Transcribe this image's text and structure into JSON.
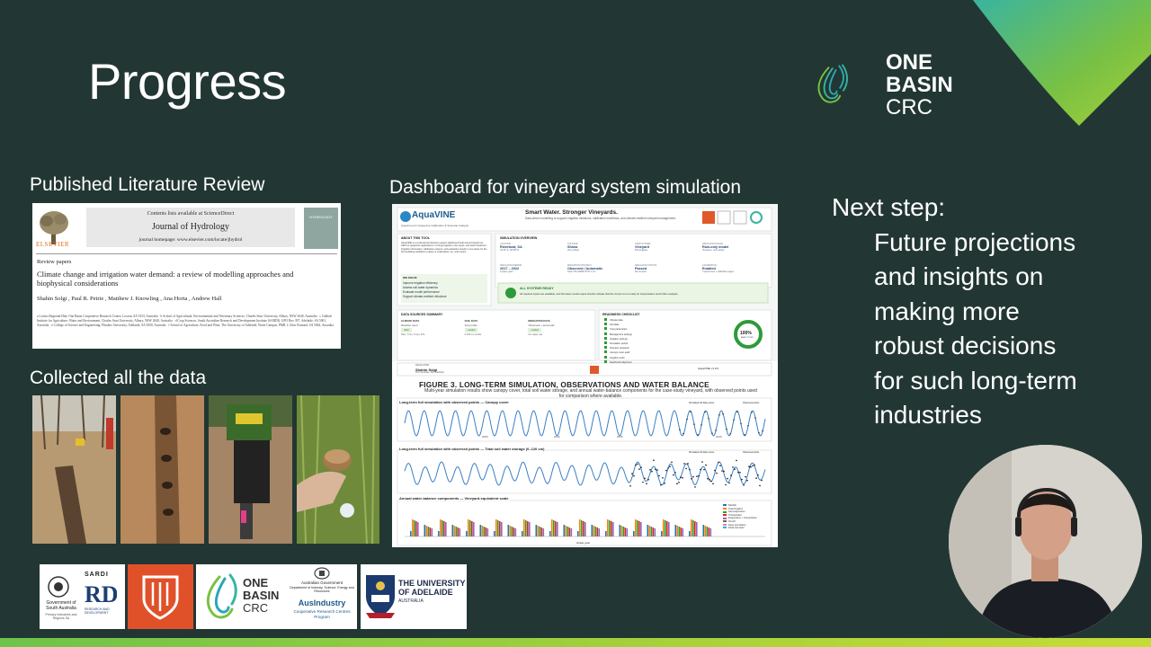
{
  "slide": {
    "title": "Progress",
    "brand_colors": {
      "background": "#223733",
      "accent_green": "#7ac143",
      "accent_teal": "#2aa7b5"
    }
  },
  "logo": {
    "line1": "ONE",
    "line2": "BASIN",
    "line3": "CRC"
  },
  "literature": {
    "heading": "Published Literature Review",
    "paper": {
      "contents_line": "Contents lists available at ScienceDirect",
      "journal": "Journal of Hydrology",
      "homepage": "journal homepage: www.elsevier.com/locate/jhydrol",
      "publisher": "ELSEVIER",
      "cover_label": "HYDROLOGY",
      "section": "Review papers",
      "title": "Climate change and irrigation water demand: a review of modelling approaches and biophysical considerations",
      "authors": "Shahin Solgi , Paul R. Petrie , Matthew J. Knowling , Ana Horta , Andrew Hall",
      "affiliations": "a Lovins Regional Hub, One Basin Cooperative Research Centre, Loxton, SA 5333, Australia · b School of Agricultural, Environmental and Veterinary Sciences, Charles Sturt University, Albury, NSW 2640, Australia · c Gulbali Institute for Agriculture, Water and Environment, Charles Sturt University, Albury, NSW 2640, Australia · d Crop Sciences, South Australian Research and Development Institute (SARDI), GPO Box 397, Adelaide, SA 5001, Australia · e College of Science and Engineering, Flinders University, Adelaide, SA 5000, Australia · f School of Agriculture, Food and Wine, The University of Adelaide, Waite Campus, PMB 1, Glen Osmond, SA 5064, Australia"
    }
  },
  "data_section": {
    "heading": "Collected all the data"
  },
  "dashboard": {
    "heading": "Dashboard for vineyard system simulation",
    "app_name": "AquaVINE",
    "app_subtitle": "AquaCrop for Grapevine Calibration & Scenario Analysis",
    "tagline": "Smart Water. Stronger Vineyards.",
    "tagline_sub": "Data-driven modelling to support irrigation decisions, calibration workflows, and climate-resilient vineyard management.",
    "about_title": "ABOUT THIS TOOL",
    "about_text": "AquaVINE is a professional decision-support dashboard built around AquaCrop-GWs for grapevine applications. It brings together crop inputs, soil water behaviour, irrigation information, calibration outputs, and evaluation results in one place for the full modelling workflow is easier to understand, run, and review.",
    "we solve": "WE SOLVE",
    "solve_items": [
      "Improve irrigation efficiency",
      "Assess soil water dynamics",
      "Evaluate model performance",
      "Support climate-resilient viticulture"
    ],
    "overview_title": "SIMULATION OVERVIEW",
    "overview": [
      {
        "label": "LOCATION",
        "value": "Riverland, SA",
        "sub": "34.19° S, 140.58° E"
      },
      {
        "label": "CULTIVAR",
        "value": "Shiraz",
        "sub": "Vitis vinifera"
      },
      {
        "label": "CROP SYSTEM",
        "value": "Vineyard",
        "sub": "Drip irrigation"
      },
      {
        "label": "SIMULATION SCALE",
        "value": "Row-only model",
        "sub": "Vineyard + row outputs"
      },
      {
        "label": "SIMULATION PERIOD",
        "value": "2017 – 2022",
        "sub": "6 grape years"
      },
      {
        "label": "IRRIGATION STRATEGY",
        "value": "Observed / Automatic",
        "sub": "Total: 678 L/MM/H 57271 mm"
      },
      {
        "label": "SIMULATION STATUS",
        "value": "Passed",
        "sub": "Run & audit"
      },
      {
        "label": "CALIBRATION",
        "value": "Enabled",
        "sub": "3 parameters + calibration pages"
      }
    ],
    "status_title": "ALL SYSTEMS READY",
    "status_text": "All required inputs are available, and the latest model output checks indicate that the current run is ready for interpretation and further analysis.",
    "sources_title": "DATA SOURCES SUMMARY",
    "sources": [
      {
        "label": "CLIMATE DATA",
        "value": "Weather input",
        "badge": "Valid",
        "sub": "Rain, Tmin, Tmax, ETo"
      },
      {
        "label": "SOIL DATA",
        "value": "Soil profile",
        "badge": "Loaded",
        "sub": "0-180 cm profile"
      },
      {
        "label": "IRRIGATION DATA",
        "value": "Observed + automatic",
        "badge": "Loaded",
        "sub": "For water use"
      }
    ],
    "checklist_title": "READINESS CHECKLIST",
    "checklist": [
      "Climate data",
      "Soil data",
      "Crop parameters",
      "Management settings",
      "Irrigation settings",
      "Simulation period",
      "Scenario prepared",
      "Canopy cover audit",
      "Irrigation audit",
      "Dashboard alignment"
    ],
    "readiness": "100%",
    "readiness_sub": "READY TO RUN",
    "developer_label": "DEVELOPER",
    "developer": "Shahin Solgi",
    "developer_sub": "PhD Candidate, AWI (Adelaide)",
    "version": "AquaVINE v1.0.0",
    "figure_title": "FIGURE 3. LONG-TERM SIMULATION, OBSERVATIONS AND WATER BALANCE",
    "figure_sub": "Multi-year simulation results show canopy cover, total soil water storage, and annual water-balance components for the case-study vineyard, with observed points used for comparison where available.",
    "panel_a_title": "Long-term full simulation with observed points — Canopy cover",
    "panel_b_title": "Long-term full simulation with observed points — Total soil water storage (0–120 cm)",
    "panel_c_title": "Annual water-balance components — Vineyard-equivalent scale",
    "legend_sim": "Simulated full daily series",
    "legend_obs": "Observed points",
    "axis_year": "Grape year",
    "tick_years": [
      "2005",
      "2010",
      "2015",
      "2020"
    ],
    "bar_legend": [
      "Rainfall",
      "Total irrigation",
      "Soil evaporation",
      "Transpiration",
      "Evaporation + Transpiration",
      "Runoff",
      "Deep percolation",
      "Delta soil water"
    ],
    "bar_colors": [
      "#1f77b4",
      "#ff7f0e",
      "#2ca02c",
      "#d62728",
      "#9467bd",
      "#8c564b",
      "#e377c2",
      "#17becf"
    ]
  },
  "next_step": {
    "heading": "Next step:",
    "lines": [
      "Future projections",
      "and insights on",
      "making more",
      "robust decisions",
      "for such long-term",
      "industries"
    ]
  },
  "sponsors": {
    "sa_gov": "Government of South Australia",
    "sa_gov_sub": "Primary Industries and Regions SA",
    "sardi": "SARDI",
    "sardi_sub": "RESEARCH AND DEVELOPMENT",
    "onebasin": [
      "ONE",
      "BASIN",
      "CRC"
    ],
    "aus_gov": "Australian Government",
    "aus_dept": "Department of Industry, Science, Energy and Resources",
    "ausindustry": "AusIndustry",
    "ausindustry_sub": "Cooperative Research Centres Program",
    "adelaide1": "THE UNIVERSITY",
    "adelaide2": "OF ADELAIDE",
    "adelaide3": "AUSTRALIA"
  }
}
